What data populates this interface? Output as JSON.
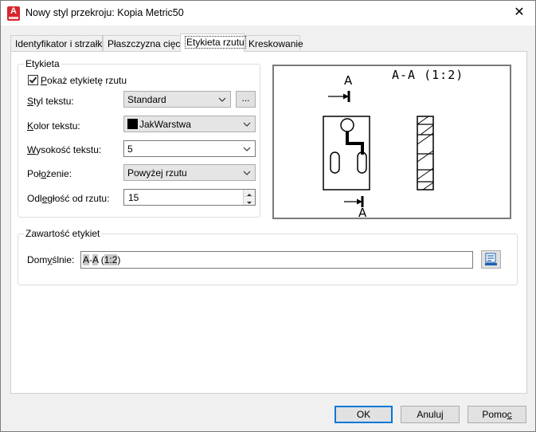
{
  "window": {
    "title": "Nowy styl przekroju: Kopia Metric50",
    "app_icon_letter": "A"
  },
  "tabs": [
    {
      "label": "Identyfikator i strzałki",
      "active": false
    },
    {
      "label": "Płaszczyzna cięcia",
      "active": false
    },
    {
      "label": "Etykieta rzutu",
      "active": true
    },
    {
      "label": "Kreskowanie",
      "active": false
    }
  ],
  "etykieta_group": {
    "title": "Etykieta",
    "show_label": {
      "label_pre": "",
      "label_ul": "P",
      "label_post": "okaż etykietę rzutu",
      "checked": true
    },
    "text_style": {
      "label_ul": "S",
      "label_post": "tyl tekstu:",
      "value": "Standard",
      "browse_label": "..."
    },
    "text_color": {
      "label_ul": "K",
      "label_post": "olor tekstu:",
      "value": "JakWarstwa",
      "swatch_color": "#000000"
    },
    "text_height": {
      "label_ul": "W",
      "label_post": "ysokość tekstu:",
      "value": "5"
    },
    "position": {
      "label_pre": "Poł",
      "label_ul": "o",
      "label_post": "żenie:",
      "value": "Powyżej rzutu"
    },
    "offset": {
      "label_pre": "Odl",
      "label_ul": "e",
      "label_post": "głość od rzutu:",
      "value": "15"
    }
  },
  "preview": {
    "label_top_letter": "A",
    "label_bottom_letter": "A",
    "view_title": "A-A (1:2)"
  },
  "content_group": {
    "title": "Zawartość etykiet",
    "default_label_pre": "Dom",
    "default_label_ul": "y",
    "default_label_post": "ślnie:",
    "value_part1": "A",
    "value_part2": "-",
    "value_part3": "A",
    "value_part4": " (",
    "value_part5": "1:2",
    "value_part6": ")"
  },
  "buttons": {
    "ok": "OK",
    "cancel": "Anuluj",
    "help_pre": "Pomo",
    "help_ul": "c"
  }
}
